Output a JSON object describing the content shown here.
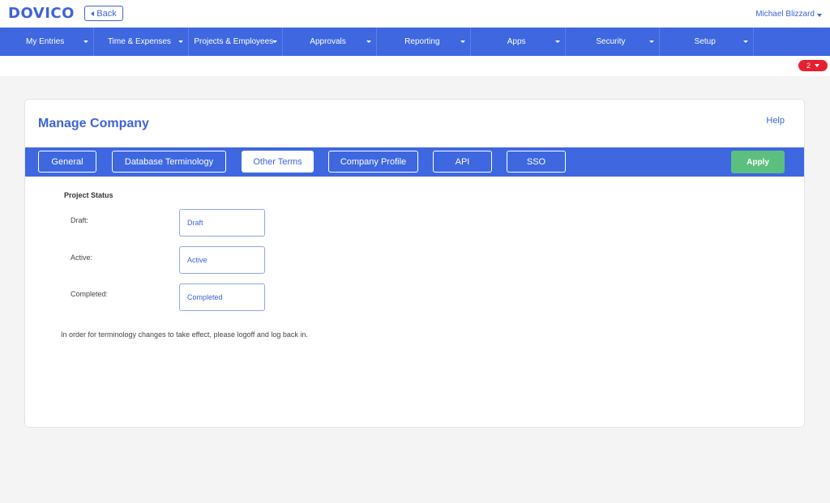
{
  "header": {
    "logo": "DOVICO",
    "back_label": "Back",
    "user_name": "Michael Blizzard"
  },
  "nav": {
    "items": [
      {
        "label": "My Entries"
      },
      {
        "label": "Time & Expenses"
      },
      {
        "label": "Projects & Employees"
      },
      {
        "label": "Approvals"
      },
      {
        "label": "Reporting"
      },
      {
        "label": "Apps"
      },
      {
        "label": "Security"
      },
      {
        "label": "Setup"
      }
    ]
  },
  "notifications": {
    "count": "2"
  },
  "panel": {
    "title": "Manage Company",
    "help_label": "Help",
    "tabs": [
      {
        "label": "General",
        "active": false
      },
      {
        "label": "Database Terminology",
        "active": false
      },
      {
        "label": "Other Terms",
        "active": true
      },
      {
        "label": "Company Profile",
        "active": false
      },
      {
        "label": "API",
        "active": false
      },
      {
        "label": "SSO",
        "active": false
      }
    ],
    "apply_label": "Apply",
    "section_title": "Project Status",
    "fields": [
      {
        "label": "Draft:",
        "value": "Draft"
      },
      {
        "label": "Active:",
        "value": "Active"
      },
      {
        "label": "Completed:",
        "value": "Completed"
      }
    ],
    "note": "In order for terminology changes to take effect, please logoff and log back in."
  },
  "colors": {
    "brand_blue": "#3e67e0",
    "apply_green": "#5cbf80",
    "notification_red": "#e8202e"
  }
}
